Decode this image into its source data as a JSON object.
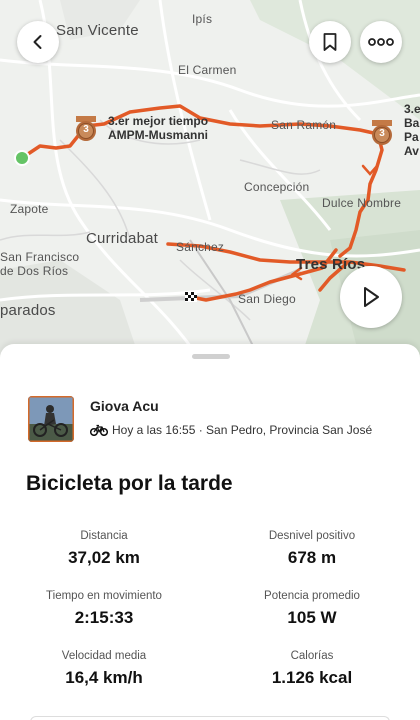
{
  "map": {
    "labels": {
      "san_vicente": "San Vicente",
      "ipis": "Ipís",
      "el_carmen": "El Carmen",
      "san_ramon": "San Ramón",
      "concepcion": "Concepción",
      "dulce_nombre": "Dulce Nombre",
      "zapote": "Zapote",
      "curridabat": "Curridabat",
      "san_francisco": "San Francisco",
      "de_dos_rios": "de Dos Ríos",
      "sanchez": "Sánchez",
      "tres_rios": "Tres Ríos",
      "san_diego": "San Diego",
      "parados": "parados"
    },
    "segment_left": {
      "line1": "3.er mejor tiempo",
      "line2": "AMPM-Musmanni",
      "rank": "3"
    },
    "segment_right": {
      "line1": "3.e",
      "line2": "Ba",
      "line3": "Pa",
      "line4": "Av",
      "rank": "3"
    },
    "route_color": "#e25a27"
  },
  "header_buttons": {
    "back": "back-icon",
    "bookmark": "bookmark-icon",
    "more": "more-icon"
  },
  "play_button": "play-icon",
  "athlete": {
    "name": "Giova Acu",
    "meta": "Hoy a las 16:55 · San Pedro, Provincia San José"
  },
  "activity": {
    "title": "Bicicleta por la tarde"
  },
  "stats": [
    {
      "label": "Distancia",
      "value": "37,02 km"
    },
    {
      "label": "Desnivel positivo",
      "value": "678 m"
    },
    {
      "label": "Tiempo en movimiento",
      "value": "2:15:33"
    },
    {
      "label": "Potencia promedio",
      "value": "105 W"
    },
    {
      "label": "Velocidad media",
      "value": "16,4 km/h"
    },
    {
      "label": "Calorías",
      "value": "1.126 kcal"
    }
  ]
}
